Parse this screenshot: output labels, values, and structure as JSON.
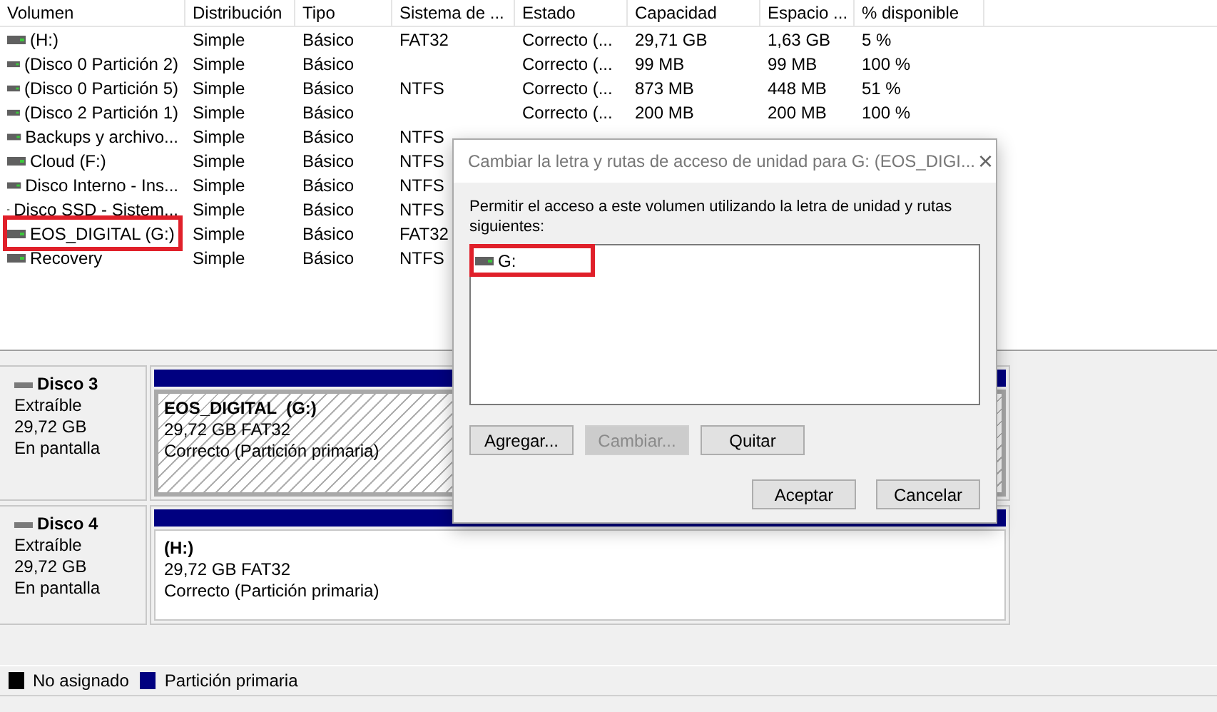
{
  "table": {
    "columns": [
      "Volumen",
      "Distribución",
      "Tipo",
      "Sistema de ...",
      "Estado",
      "Capacidad",
      "Espacio ...",
      "% disponible"
    ],
    "rows": [
      {
        "cells": [
          "(H:)",
          "Simple",
          "Básico",
          "FAT32",
          "Correcto (...",
          "29,71 GB",
          "1,63 GB",
          "5 %"
        ],
        "highlighted": false
      },
      {
        "cells": [
          "(Disco 0 Partición 2)",
          "Simple",
          "Básico",
          "",
          "Correcto (...",
          "99 MB",
          "99 MB",
          "100 %"
        ],
        "highlighted": false
      },
      {
        "cells": [
          "(Disco 0 Partición 5)",
          "Simple",
          "Básico",
          "NTFS",
          "Correcto (...",
          "873 MB",
          "448 MB",
          "51 %"
        ],
        "highlighted": false
      },
      {
        "cells": [
          "(Disco 2 Partición 1)",
          "Simple",
          "Básico",
          "",
          "Correcto (...",
          "200 MB",
          "200 MB",
          "100 %"
        ],
        "highlighted": false
      },
      {
        "cells": [
          "Backups y archivo...",
          "Simple",
          "Básico",
          "NTFS"
        ],
        "highlighted": false
      },
      {
        "cells": [
          "Cloud (F:)",
          "Simple",
          "Básico",
          "NTFS"
        ],
        "highlighted": false
      },
      {
        "cells": [
          "Disco Interno - Ins...",
          "Simple",
          "Básico",
          "NTFS"
        ],
        "highlighted": false
      },
      {
        "cells": [
          "Disco SSD - Sistem...",
          "Simple",
          "Básico",
          "NTFS"
        ],
        "highlighted": false
      },
      {
        "cells": [
          "EOS_DIGITAL (G:)",
          "Simple",
          "Básico",
          "FAT32"
        ],
        "highlighted": true
      },
      {
        "cells": [
          "Recovery",
          "Simple",
          "Básico",
          "NTFS"
        ],
        "highlighted": false
      }
    ]
  },
  "disks": [
    {
      "name": "Disco 3",
      "type": "Extraíble",
      "size": "29,72 GB",
      "status": "En pantalla",
      "partition": {
        "label": "EOS_DIGITAL  (G:)",
        "size_fs": "29,72 GB FAT32",
        "status": "Correcto (Partición primaria)",
        "selected": true
      }
    },
    {
      "name": "Disco 4",
      "type": "Extraíble",
      "size": "29,72 GB",
      "status": "En pantalla",
      "partition": {
        "label": "(H:)",
        "size_fs": "29,72 GB FAT32",
        "status": "Correcto (Partición primaria)",
        "selected": false
      }
    }
  ],
  "legend": [
    {
      "label": "No asignado",
      "color": "#000000"
    },
    {
      "label": "Partición primaria",
      "color": "#000080"
    }
  ],
  "dialog": {
    "title": "Cambiar la letra y rutas de acceso de unidad para G: (EOS_DIGI...",
    "close": "×",
    "description": "Permitir el acceso a este volumen utilizando la letra de unidad y rutas siguientes:",
    "paths": [
      {
        "label": "G:",
        "highlighted": true
      }
    ],
    "buttons": [
      {
        "label": "Agregar...",
        "disabled": false
      },
      {
        "label": "Cambiar...",
        "disabled": true
      },
      {
        "label": "Quitar",
        "disabled": false
      }
    ],
    "footer_buttons": [
      "Aceptar",
      "Cancelar"
    ]
  }
}
